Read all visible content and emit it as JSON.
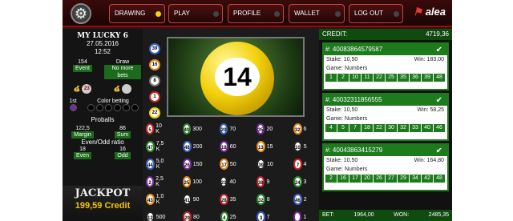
{
  "nav": {
    "drawing": "DRAWING",
    "play": "PLAY",
    "profile": "PROFILE",
    "wallet": "WALLET",
    "logout": "LOG OUT",
    "brand": "alea"
  },
  "left": {
    "title": "MY LUCKY 6",
    "date": "27.05.2016",
    "time": "12:52",
    "event_val": "154",
    "event_lbl": "Event",
    "draw_val": "Draw",
    "draw_sub": "No more bets",
    "coin1": "23",
    "first": "1st",
    "color_betting": "Color betting",
    "proballs": "Proballs",
    "margin_val": "122,5",
    "margin_lbl": "Margin",
    "sum_val": "86",
    "sum_lbl": "Sum",
    "evenodd": "Even/Odd ratio",
    "even_val": "18",
    "even_lbl": "Even",
    "odd_val": "16",
    "odd_lbl": "Odd",
    "jackpot": "JACKPOT",
    "credit": "199,59 Credit"
  },
  "main": {
    "ball": "14"
  },
  "history": [
    "39",
    "16",
    "8",
    "1",
    "22"
  ],
  "stats": [
    {
      "b": "5",
      "l": "10 K"
    },
    {
      "b": "47",
      "l": "7,5 K"
    },
    {
      "b": "44",
      "l": "5,0 K"
    },
    {
      "b": "2",
      "l": "2,5 K"
    },
    {
      "b": "43",
      "l": "1,0 K"
    },
    {
      "b": "12",
      "l": "500"
    },
    {
      "b": "40",
      "l": "300"
    },
    {
      "b": "48",
      "l": "200"
    },
    {
      "b": "26",
      "l": "150"
    },
    {
      "b": "25",
      "l": "100"
    },
    {
      "b": "41",
      "l": "90"
    },
    {
      "b": "29",
      "l": "80"
    },
    {
      "b": "20",
      "l": "70"
    },
    {
      "b": "18",
      "l": "60"
    },
    {
      "b": "17",
      "l": "50"
    },
    {
      "b": "23",
      "l": "40"
    },
    {
      "b": "28",
      "l": "35"
    },
    {
      "b": "4",
      "l": "25"
    },
    {
      "b": "35",
      "l": "20"
    },
    {
      "b": "13",
      "l": "15"
    },
    {
      "b": "39",
      "l": "10"
    },
    {
      "b": "38",
      "l": "9"
    },
    {
      "b": "32",
      "l": "8"
    },
    {
      "b": "3",
      "l": "7"
    },
    {
      "b": "32",
      "l": "6"
    },
    {
      "b": "10",
      "l": "5"
    },
    {
      "b": "7",
      "l": "4"
    },
    {
      "b": "24",
      "l": "3"
    },
    {
      "b": "46",
      "l": "2"
    },
    {
      "b": "",
      "l": "1"
    }
  ],
  "right": {
    "credit_lbl": "CREDIT:",
    "credit_val": "4719,36",
    "tickets": [
      {
        "id": "#: 40083864579587",
        "stake": "Stake: 10,50",
        "win": "Win: 183,00",
        "game": "Game: Numbers",
        "nums": [
          "1",
          "2",
          "10",
          "11",
          "22",
          "25",
          "35",
          "36",
          "39",
          "48"
        ]
      },
      {
        "id": "#: 40032311856555",
        "stake": "Stake: 10,50",
        "win": "Win: 58,25",
        "game": "Game: Numbers",
        "nums": [
          "4",
          "5",
          "7",
          "18",
          "22",
          "30",
          "32",
          "33",
          "40",
          "46"
        ]
      },
      {
        "id": "#: 40043863415279",
        "stake": "Stake: 10,50",
        "win": "Win: 164,80",
        "game": "Game: Numbers",
        "nums": [
          "2",
          "16",
          "17",
          "20",
          "26",
          "27",
          "29",
          "34",
          "42",
          "48"
        ]
      }
    ],
    "bet_lbl": "BET:",
    "bet_val": "1964,00",
    "won_lbl": "WON:",
    "won_val": "2485,35"
  }
}
